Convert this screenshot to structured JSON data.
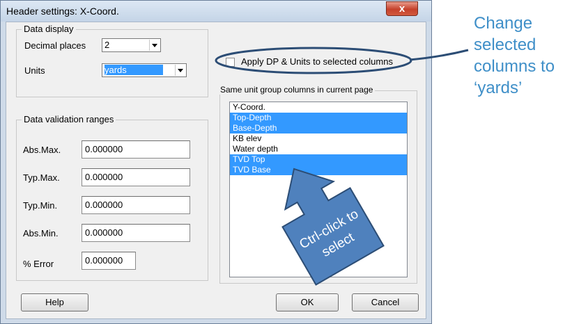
{
  "dialog": {
    "title": "Header settings: X-Coord.",
    "close_glyph": "x"
  },
  "data_display": {
    "legend": "Data display",
    "decimal_label": "Decimal places",
    "decimal_value": "2",
    "units_label": "Units",
    "units_value": "yards"
  },
  "apply_checkbox": {
    "label": "Apply DP & Units to selected columns",
    "checked": false
  },
  "validation": {
    "legend": "Data validation ranges",
    "rows": [
      {
        "label": "Abs.Max.",
        "value": "0.000000"
      },
      {
        "label": "Typ.Max.",
        "value": "0.000000"
      },
      {
        "label": "Typ.Min.",
        "value": "0.000000"
      },
      {
        "label": "Abs.Min.",
        "value": "0.000000"
      },
      {
        "label": "% Error",
        "value": "0.000000"
      }
    ]
  },
  "group_list": {
    "legend": "Same unit group columns in current page",
    "items": [
      {
        "label": "Y-Coord.",
        "selected": false
      },
      {
        "label": "Top-Depth",
        "selected": true
      },
      {
        "label": "Base-Depth",
        "selected": true
      },
      {
        "label": "KB elev",
        "selected": false
      },
      {
        "label": "Water depth",
        "selected": false
      },
      {
        "label": "TVD Top",
        "selected": true
      },
      {
        "label": "TVD Base",
        "selected": true
      }
    ]
  },
  "buttons": {
    "help": "Help",
    "ok": "OK",
    "cancel": "Cancel"
  },
  "annotation": {
    "line1": "Change",
    "line2": "selected",
    "line3": "columns to",
    "line4": "‘yards’"
  },
  "callout_arrow": {
    "line1": "Ctrl-click to",
    "line2": "select"
  },
  "colors": {
    "selection": "#3399ff",
    "callout_fill": "#4f81bd",
    "callout_border": "#2c4d75",
    "annotation_text": "#3f8fc8"
  }
}
